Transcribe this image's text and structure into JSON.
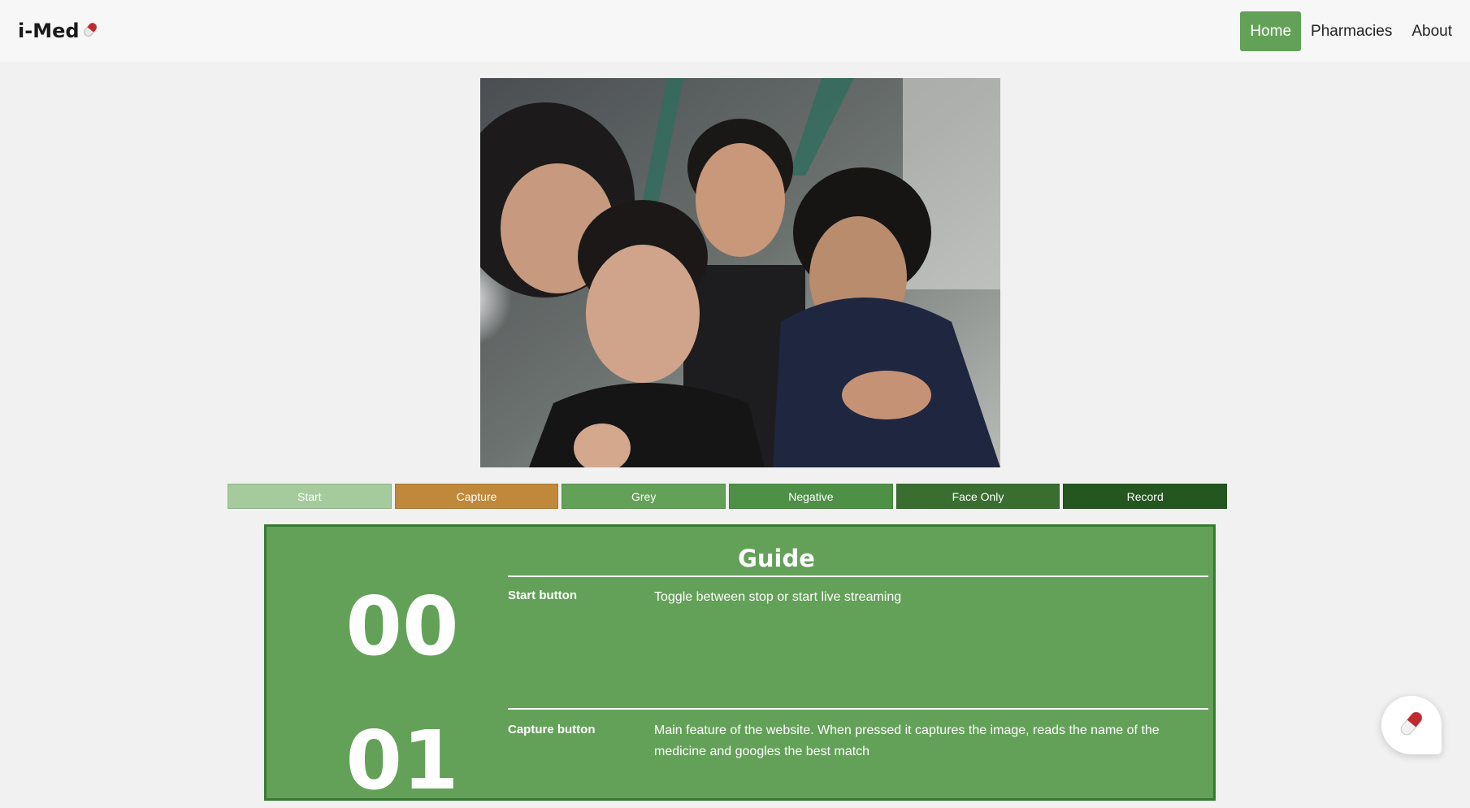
{
  "navbar": {
    "brand": "i-Med",
    "brand_icon": "pill-icon",
    "links": [
      {
        "label": "Home",
        "active": true
      },
      {
        "label": "Pharmacies",
        "active": false
      },
      {
        "label": "About",
        "active": false
      }
    ],
    "active_color": "#63a158"
  },
  "webcam": {
    "description_icon": "webcam-feed"
  },
  "controls": {
    "buttons": [
      {
        "label": "Start",
        "color": "#a5cb9d"
      },
      {
        "label": "Capture",
        "color": "#c0883a"
      },
      {
        "label": "Grey",
        "color": "#63a158"
      },
      {
        "label": "Negative",
        "color": "#4e9046"
      },
      {
        "label": "Face Only",
        "color": "#3a6e31"
      },
      {
        "label": "Record",
        "color": "#24561f"
      }
    ]
  },
  "guide": {
    "title": "Guide",
    "steps": [
      {
        "number": "00",
        "label": "Start button",
        "description": "Toggle between stop or start live streaming"
      },
      {
        "number": "01",
        "label": "Capture button",
        "description": "Main feature of the website. When pressed it captures the image, reads the name of the medicine and googles the best match"
      }
    ],
    "background": "#63a158",
    "border": "#377a31"
  },
  "chat_button": {
    "icon": "pill-icon"
  }
}
